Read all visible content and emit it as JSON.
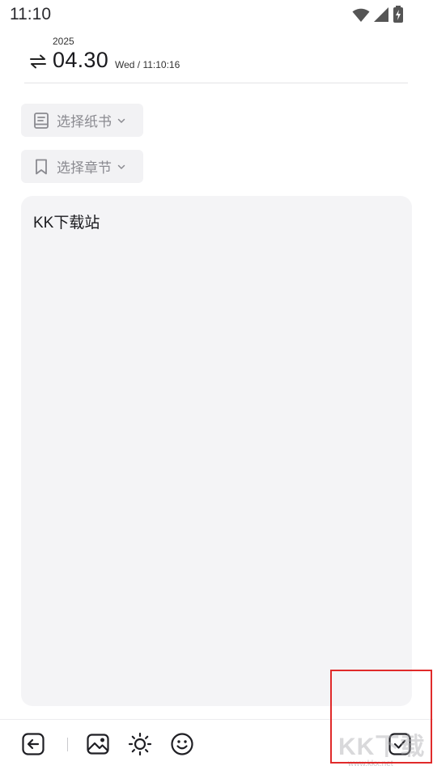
{
  "status_bar": {
    "time": "11:10"
  },
  "date": {
    "year": "2025",
    "date_main": "04.30",
    "date_sub": "Wed / 11:10:16"
  },
  "chips": {
    "notebook_label": "选择纸书",
    "chapter_label": "选择章节"
  },
  "editor": {
    "content": "KK下载站"
  },
  "toolbar": {
    "icons": [
      "back-icon",
      "image-icon",
      "sun-icon",
      "emoji-icon",
      "check-icon"
    ]
  },
  "watermark": {
    "text": "KK下载",
    "url": "www.kkx.net"
  },
  "colors": {
    "highlight": "#e02a2a",
    "chip_bg": "#f2f2f4",
    "editor_bg": "#f4f4f6"
  }
}
